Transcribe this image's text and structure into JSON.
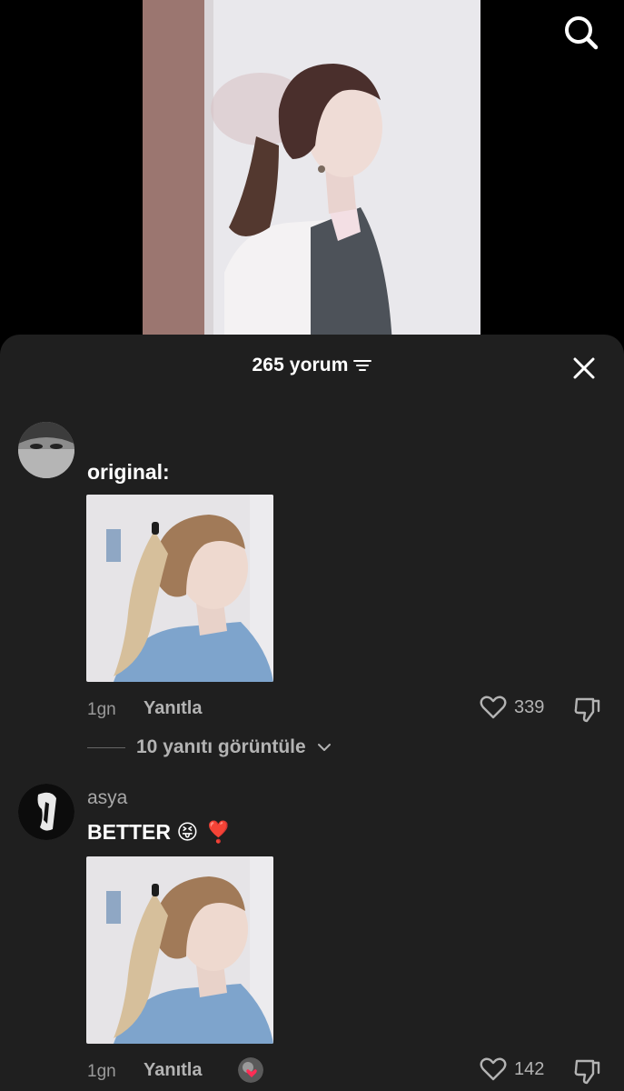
{
  "sheet": {
    "comment_count": "265 yorum"
  },
  "comments": [
    {
      "username": "",
      "text": "original:",
      "time": "1gn",
      "reply_label": "Yanıtla",
      "likes": "339",
      "view_replies": "10 yanıtı görüntüle"
    },
    {
      "username": "asya",
      "text": "BETTER",
      "emojis": "😝 ❣️",
      "time": "1gn",
      "reply_label": "Yanıtla",
      "likes": "142"
    }
  ],
  "colors": {
    "background": "#000000",
    "sheet": "#1f1f1f",
    "like_heart": "#ff2d55"
  },
  "icons": [
    "search-icon",
    "filter-icon",
    "close-icon",
    "heart-icon",
    "dislike-icon",
    "chevron-down-icon"
  ]
}
